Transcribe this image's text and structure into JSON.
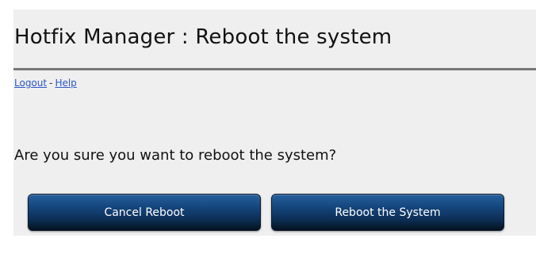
{
  "header": {
    "title": "Hotfix Manager : Reboot the system"
  },
  "links": {
    "logout": "Logout",
    "separator": "-",
    "help": "Help"
  },
  "main": {
    "question": "Are you sure you want to reboot the system?",
    "cancel_label": "Cancel Reboot",
    "reboot_label": "Reboot the System"
  },
  "colors": {
    "panel_background": "#efefef",
    "link": "#2a55c6",
    "button_top": "#27609d",
    "button_bottom": "#05121f"
  }
}
